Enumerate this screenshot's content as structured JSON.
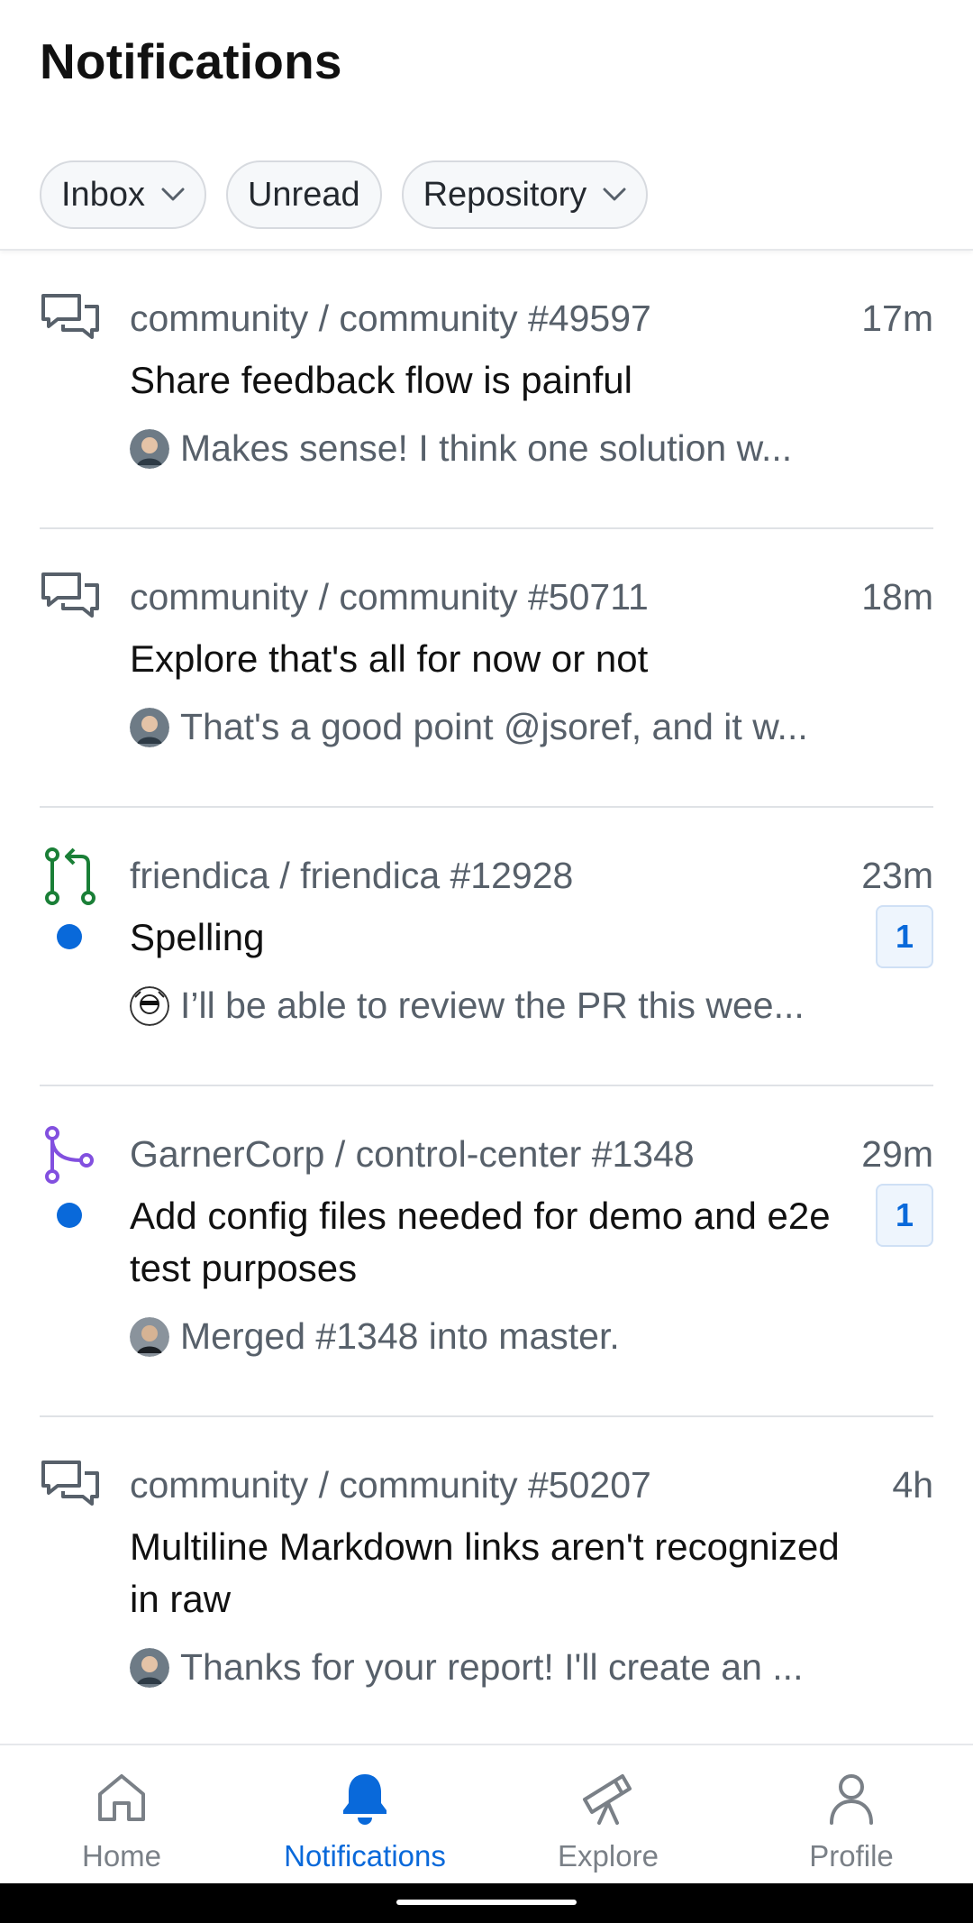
{
  "header": {
    "title": "Notifications",
    "filters": [
      {
        "label": "Inbox",
        "has_dropdown": true
      },
      {
        "label": "Unread",
        "has_dropdown": false
      },
      {
        "label": "Repository",
        "has_dropdown": true
      }
    ]
  },
  "notifications": [
    {
      "type_icon": "discussion-icon",
      "repo": "community / community #49597",
      "time": "17m",
      "title": "Share feedback flow is painful",
      "preview": "Makes sense! I think one solution w...",
      "unread": false,
      "badge": null
    },
    {
      "type_icon": "discussion-icon",
      "repo": "community / community #50711",
      "time": "18m",
      "title": "Explore that's all for now or not",
      "preview": "That's a good point @jsoref, and it w...",
      "unread": false,
      "badge": null
    },
    {
      "type_icon": "pull-request-icon",
      "repo": "friendica / friendica #12928",
      "time": "23m",
      "title": "Spelling",
      "preview": "I’ll be able to review the PR this wee...",
      "unread": true,
      "badge": "1"
    },
    {
      "type_icon": "merged-pr-icon",
      "repo": "GarnerCorp / control-center #1348",
      "time": "29m",
      "title": "Add config files needed for demo and e2e test purposes",
      "preview": "Merged #1348 into master.",
      "unread": true,
      "badge": "1"
    },
    {
      "type_icon": "discussion-icon",
      "repo": "community / community #50207",
      "time": "4h",
      "title": "Multiline Markdown links aren't recognized in raw",
      "preview": "Thanks for your report! I'll create an ...",
      "unread": false,
      "badge": null
    }
  ],
  "tabbar": {
    "items": [
      {
        "label": "Home",
        "icon": "home-icon",
        "active": false
      },
      {
        "label": "Notifications",
        "icon": "bell-icon",
        "active": true
      },
      {
        "label": "Explore",
        "icon": "telescope-icon",
        "active": false
      },
      {
        "label": "Profile",
        "icon": "person-icon",
        "active": false
      }
    ]
  },
  "colors": {
    "accent": "#0969da",
    "pr_open": "#1a7f37",
    "pr_merged": "#8250df",
    "muted_text": "#57606a"
  }
}
